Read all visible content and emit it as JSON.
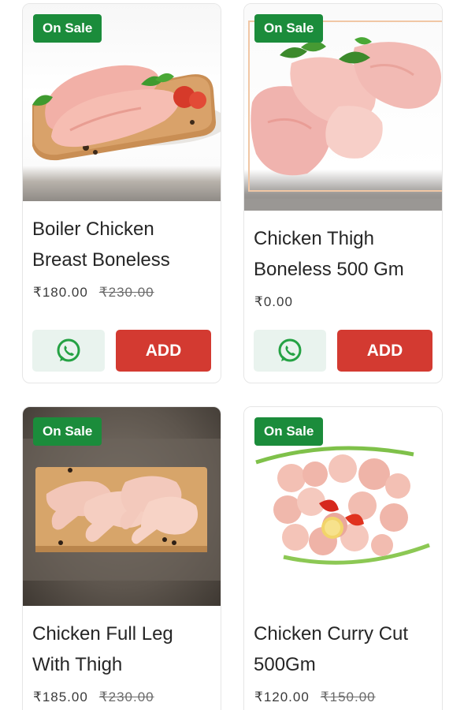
{
  "products": [
    {
      "badge": "On Sale",
      "title_line1": "Boiler Chicken",
      "title_line2": "Breast Boneless",
      "price": "₹180.00",
      "old_price": "₹230.00",
      "add_label": "ADD"
    },
    {
      "badge": "On Sale",
      "title_line1": "Chicken Thigh",
      "title_line2": "Boneless 500 Gm",
      "price": "₹0.00",
      "old_price": "",
      "add_label": "ADD"
    },
    {
      "badge": "On Sale",
      "title_line1": "Chicken Full Leg",
      "title_line2": "With Thigh",
      "price": "₹185.00",
      "old_price": "₹230.00"
    },
    {
      "badge": "On Sale",
      "title_line1": "Chicken Curry Cut",
      "title_line2": "500Gm",
      "price": "₹120.00",
      "old_price": "₹150.00"
    }
  ],
  "colors": {
    "badge": "#1b8c3b",
    "add_button": "#d33a31",
    "whatsapp": "#25a244"
  },
  "icons": {
    "whatsapp": "whatsapp-icon"
  }
}
